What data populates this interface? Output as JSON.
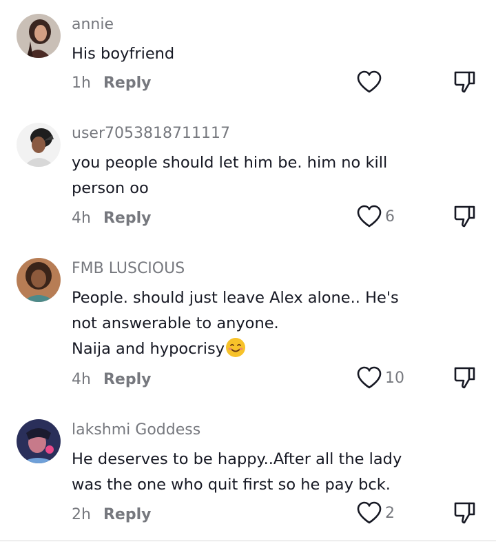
{
  "comments": [
    {
      "username": "annie",
      "text_lines": [
        "His boyfriend"
      ],
      "time": "1h",
      "reply_label": "Reply",
      "like_count": ""
    },
    {
      "username": "user7053818711117",
      "text_lines": [
        "you people should let him be. him no kill",
        "person oo"
      ],
      "time": "4h",
      "reply_label": "Reply",
      "like_count": "6"
    },
    {
      "username": "FMB LUSCIOUS",
      "text_lines": [
        "People. should just leave Alex alone.. He's",
        "not answerable to anyone.",
        "Naija and hypocrisy"
      ],
      "time": "4h",
      "reply_label": "Reply",
      "like_count": "10"
    },
    {
      "username": "lakshmi Goddess",
      "text_lines": [
        "He deserves to be happy..After all the lady",
        "was the one who quit first so he pay bck."
      ],
      "time": "2h",
      "reply_label": "Reply",
      "like_count": "2"
    }
  ],
  "icons": {
    "like": "heart-outline-icon",
    "dislike": "thumbs-down-outline-icon",
    "emoji": "smiling-face-emoji"
  },
  "colors": {
    "text": "#161823",
    "secondary_text": "#76787e",
    "icon": "#161823"
  }
}
